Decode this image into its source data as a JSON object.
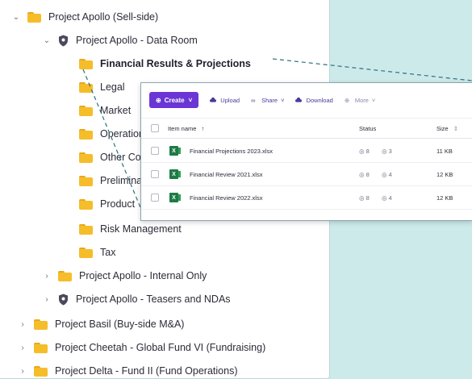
{
  "tree": [
    {
      "label": "Project Apollo (Sell-side)",
      "level": 0,
      "expanded": true,
      "icon": "folder-icon",
      "bold": false
    },
    {
      "label": "Project Apollo - Data Room",
      "level": 1,
      "expanded": true,
      "icon": "shield-icon",
      "bold": false
    },
    {
      "label": "Financial Results & Projections",
      "level": 2,
      "icon": "folder-icon",
      "bold": true
    },
    {
      "label": "Legal",
      "level": 2,
      "icon": "folder-icon",
      "bold": false
    },
    {
      "label": "Market",
      "level": 2,
      "icon": "folder-icon",
      "bold": false
    },
    {
      "label": "Operations",
      "level": 2,
      "icon": "folder-icon",
      "bold": false
    },
    {
      "label": "Other Company",
      "level": 2,
      "icon": "folder-icon",
      "bold": false
    },
    {
      "label": "Preliminary",
      "level": 2,
      "icon": "folder-icon",
      "bold": false
    },
    {
      "label": "Product",
      "level": 2,
      "icon": "folder-icon",
      "bold": false
    },
    {
      "label": "Risk Management",
      "level": 2,
      "icon": "folder-icon",
      "bold": false
    },
    {
      "label": "Tax",
      "level": 2,
      "icon": "folder-icon",
      "bold": false
    },
    {
      "label": "Project Apollo - Internal Only",
      "level": 1,
      "expanded": false,
      "icon": "folder-icon",
      "bold": false
    },
    {
      "label": "Project Apollo - Teasers and NDAs",
      "level": 1,
      "expanded": false,
      "icon": "shield-icon",
      "bold": false
    },
    {
      "label": "Project Basil (Buy-side M&A)",
      "level": 0,
      "expanded": false,
      "icon": "folder-icon",
      "bold": false
    },
    {
      "label": "Project Cheetah - Global Fund VI (Fundraising)",
      "level": 0,
      "expanded": false,
      "icon": "folder-icon",
      "bold": false
    },
    {
      "label": "Project Delta - Fund II (Fund Operations)",
      "level": 0,
      "expanded": false,
      "icon": "folder-icon",
      "bold": false
    }
  ],
  "toolbar": {
    "create": "Create",
    "upload": "Upload",
    "share": "Share",
    "download": "Download",
    "more": "More"
  },
  "columns": {
    "name": "Item name",
    "status": "Status",
    "size": "Size"
  },
  "files": [
    {
      "name": "Financial Projections 2023.xlsx",
      "status_a": "8",
      "status_b": "3",
      "size": "11 KB"
    },
    {
      "name": "Financial Review 2021.xlsx",
      "status_a": "8",
      "status_b": "4",
      "size": "12 KB"
    },
    {
      "name": "Financial Review 2022.xlsx",
      "status_a": "8",
      "status_b": "4",
      "size": "12 KB"
    }
  ],
  "colors": {
    "accent": "#6b35d6",
    "folder": "#f6bd2a",
    "excel": "#1e7a45",
    "background": "#cdeaea"
  }
}
